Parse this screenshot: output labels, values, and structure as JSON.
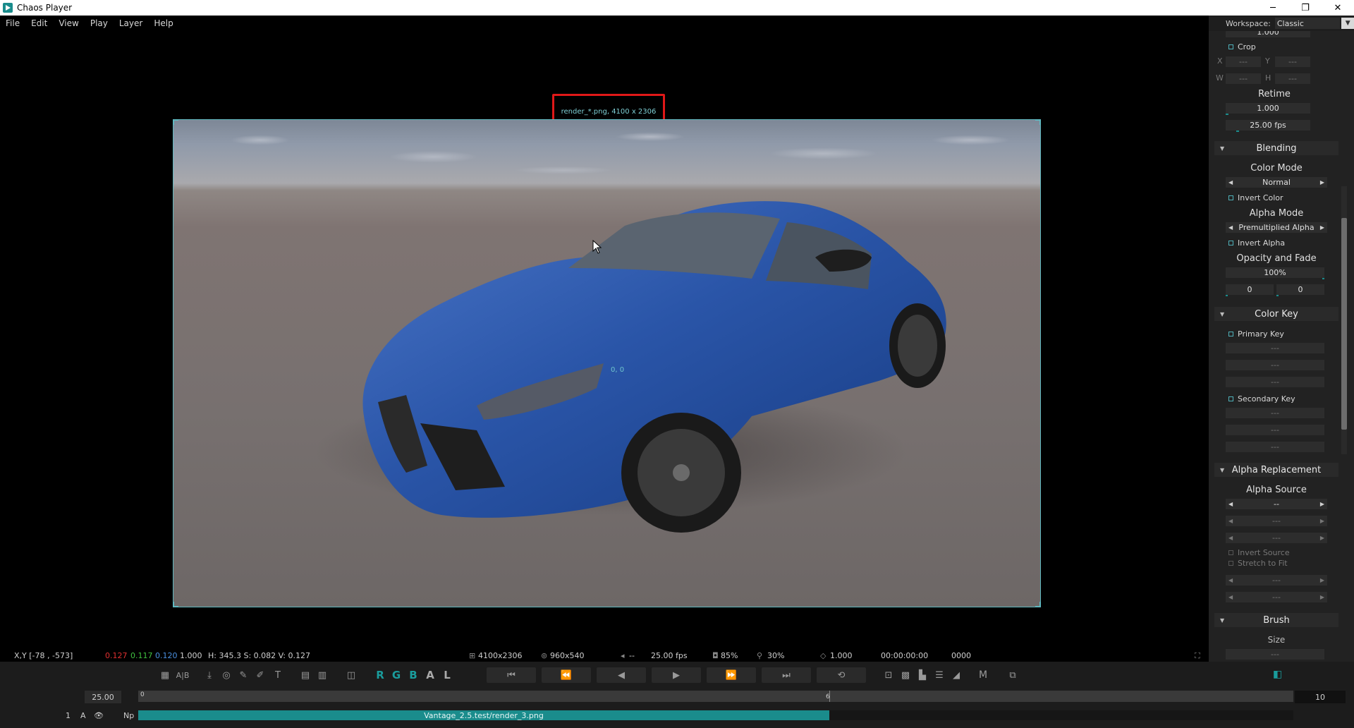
{
  "window": {
    "title": "Chaos Player",
    "controls": {
      "minimize": "─",
      "maximize": "❐",
      "close": "✕"
    }
  },
  "menu": [
    "File",
    "Edit",
    "View",
    "Play",
    "Layer",
    "Help"
  ],
  "workspace": {
    "label": "Workspace:",
    "value": "Classic"
  },
  "viewer": {
    "image_label": "render_*.png, 4100 x 2306",
    "origin_label": "0, 0"
  },
  "status": {
    "xy": "X,Y [-78 , -573]",
    "r": "0.127",
    "g": "0.117",
    "b": "0.120",
    "a": "1.000",
    "hsv": "H: 345.3  S: 0.082  V: 0.127",
    "resolution": "4100x2306",
    "display_res": "960x540",
    "audio": "--",
    "fps": "25.00 fps",
    "quality": "85%",
    "zoom": "30%",
    "aspect": "1.000",
    "timecode": "00:00:00:00",
    "frame": "0000"
  },
  "toolbar": {
    "channels": [
      "R",
      "G",
      "B",
      "A",
      "L"
    ],
    "m_label": "M",
    "ab_label": "A|B",
    "t_label": "T"
  },
  "timeline": {
    "fps": "25.00",
    "start": "0",
    "marker": "6",
    "end": "10",
    "layer_index": "1",
    "layer_a": "A",
    "layer_np": "Np",
    "clip_name": "Vantage_2.5.test/render_3.png"
  },
  "panel": {
    "top_value": "1.000",
    "crop": {
      "label": "Crop",
      "x_label": "X",
      "y_label": "Y",
      "w_label": "W",
      "h_label": "H",
      "x": "---",
      "y": "---",
      "w": "---",
      "h": "---"
    },
    "retime": {
      "label": "Retime",
      "speed": "1.000",
      "fps": "25.00 fps"
    },
    "blending": {
      "heading": "Blending",
      "color_mode_label": "Color Mode",
      "color_mode": "Normal",
      "invert_color": "Invert Color",
      "alpha_mode_label": "Alpha Mode",
      "alpha_mode": "Premultiplied Alpha",
      "invert_alpha": "Invert Alpha",
      "opacity_label": "Opacity and Fade",
      "opacity": "100%",
      "fade_in": "0",
      "fade_out": "0"
    },
    "color_key": {
      "heading": "Color Key",
      "primary": "Primary Key",
      "secondary": "Secondary Key",
      "placeholder": "---"
    },
    "alpha_replacement": {
      "heading": "Alpha Replacement",
      "source_label": "Alpha Source",
      "source": "--",
      "placeholder": "---",
      "invert_source": "Invert Source",
      "stretch": "Stretch to Fit"
    },
    "brush": {
      "heading": "Brush",
      "size_label": "Size",
      "size": "---"
    }
  },
  "colors": {
    "accent": "#1a8c8c",
    "highlight_box": "#e01818",
    "red_value": "#e03030",
    "green_value": "#40c040",
    "blue_value": "#4a90e0"
  }
}
